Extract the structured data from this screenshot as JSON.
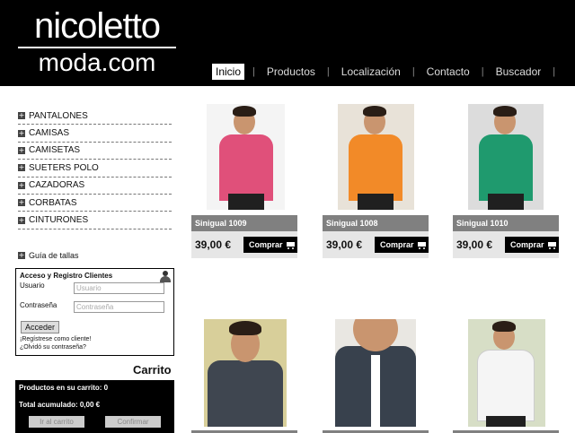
{
  "logo": {
    "line1": "nicoletto",
    "line2": "moda.com"
  },
  "nav": {
    "items": [
      {
        "label": "Inicio",
        "active": true
      },
      {
        "label": "Productos"
      },
      {
        "label": "Localización"
      },
      {
        "label": "Contacto"
      },
      {
        "label": "Buscador"
      }
    ],
    "separator": "|"
  },
  "sidebar": {
    "categories": [
      "PANTALONES",
      "CAMISAS",
      "CAMISETAS",
      "SUETERS POLO",
      "CAZADORAS",
      "CORBATAS",
      "CINTURONES"
    ],
    "size_guide": "Guía de tallas",
    "login": {
      "title": "Acceso y Registro Clientes",
      "user_label": "Usuario",
      "user_placeholder": "Usuario",
      "pass_label": "Contraseña",
      "pass_placeholder": "Contraseña",
      "button": "Acceder",
      "register_link": "¡Regístrese como cliente!",
      "forgot_link": "¿Olvidó su contraseña?"
    },
    "cart": {
      "title": "Carrito",
      "items_text": "Productos en su carrito: 0",
      "total_text": "Total acumulado: 0,00 €",
      "go_button": "Ir al carrito",
      "confirm_button": "Confirmar"
    }
  },
  "products": [
    {
      "name": "Sinigual 1009",
      "price": "39,00 €",
      "buy": "Comprar",
      "shirt_color": "#e0507a",
      "bg_color": "#f4f4f4"
    },
    {
      "name": "Sinigual 1008",
      "price": "39,00 €",
      "buy": "Comprar",
      "shirt_color": "#f28a28",
      "bg_color": "#e8e2d8"
    },
    {
      "name": "Sinigual 1010",
      "price": "39,00 €",
      "buy": "Comprar",
      "shirt_color": "#1f9a6e",
      "bg_color": "#dcdcdc"
    },
    {
      "shirt_color": "#3f4650",
      "bg_color": "#d8cf9a"
    },
    {
      "shirt_color": "#38414d",
      "bg_color": "#e9e7e2"
    },
    {
      "shirt_color": "#f5f5f5",
      "bg_color": "#d7dec6"
    }
  ]
}
